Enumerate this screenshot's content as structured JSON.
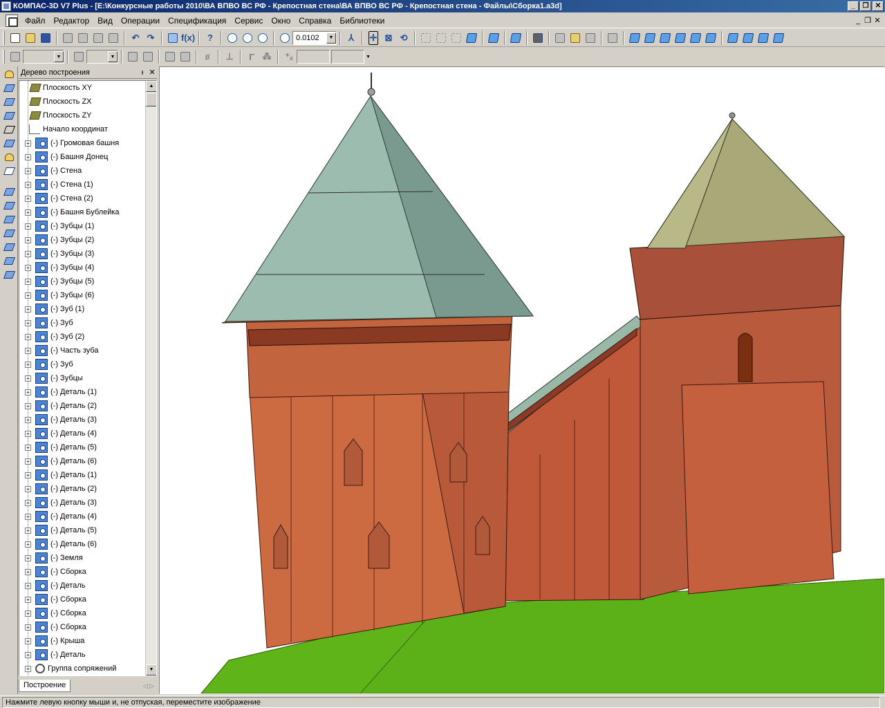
{
  "window": {
    "title": "КОМПАС-3D V7 Plus - [E:\\Конкурсные работы 2010\\ВА ВПВО ВС РФ - Крепостная стена\\ВА ВПВО ВС РФ - Крепостная стена - Файлы\\Сборка1.a3d]",
    "minimize": "_",
    "restore": "❐",
    "close": "✕"
  },
  "menu": {
    "items": [
      "Файл",
      "Редактор",
      "Вид",
      "Операции",
      "Спецификация",
      "Сервис",
      "Окно",
      "Справка",
      "Библиотеки"
    ]
  },
  "toolbar": {
    "zoom_value": "0.0102"
  },
  "tree": {
    "header": "Дерево построения",
    "pin": "ᵻ",
    "close": "✕",
    "rows": [
      {
        "type": "plane",
        "label": "Плоскость XY"
      },
      {
        "type": "plane",
        "label": "Плоскость ZX"
      },
      {
        "type": "plane",
        "label": "Плоскость ZY"
      },
      {
        "type": "origin",
        "label": "Начало координат"
      },
      {
        "type": "comp",
        "label": "(-) Громовая башня"
      },
      {
        "type": "comp",
        "label": "(-) Башня Донец"
      },
      {
        "type": "comp",
        "label": "(-) Стена"
      },
      {
        "type": "comp",
        "label": "(-) Стена (1)"
      },
      {
        "type": "comp",
        "label": "(-) Стена (2)"
      },
      {
        "type": "comp",
        "label": "(-) Башня Бублейка"
      },
      {
        "type": "comp",
        "label": "(-) Зубцы (1)"
      },
      {
        "type": "comp",
        "label": "(-) Зубцы (2)"
      },
      {
        "type": "comp",
        "label": "(-) Зубцы (3)"
      },
      {
        "type": "comp",
        "label": "(-) Зубцы (4)"
      },
      {
        "type": "comp",
        "label": "(-) Зубцы (5)"
      },
      {
        "type": "comp",
        "label": "(-) Зубцы (6)"
      },
      {
        "type": "comp",
        "label": "(-) Зуб (1)"
      },
      {
        "type": "comp",
        "label": "(-) Зуб"
      },
      {
        "type": "comp",
        "label": "(-) Зуб (2)"
      },
      {
        "type": "comp",
        "label": "(-) Часть зуба"
      },
      {
        "type": "comp",
        "label": "(-) Зуб"
      },
      {
        "type": "comp",
        "label": "(-) Зубцы"
      },
      {
        "type": "comp",
        "label": "(-) Деталь (1)"
      },
      {
        "type": "comp",
        "label": "(-) Деталь (2)"
      },
      {
        "type": "comp",
        "label": "(-) Деталь (3)"
      },
      {
        "type": "comp",
        "label": "(-) Деталь (4)"
      },
      {
        "type": "comp",
        "label": "(-) Деталь (5)"
      },
      {
        "type": "comp",
        "label": "(-) Деталь (6)"
      },
      {
        "type": "comp",
        "label": "(-) Деталь (1)"
      },
      {
        "type": "comp",
        "label": "(-) Деталь (2)"
      },
      {
        "type": "comp",
        "label": "(-) Деталь (3)"
      },
      {
        "type": "comp",
        "label": "(-) Деталь (4)"
      },
      {
        "type": "comp",
        "label": "(-) Деталь (5)"
      },
      {
        "type": "comp",
        "label": "(-) Деталь (6)"
      },
      {
        "type": "comp",
        "label": "(-) Земля"
      },
      {
        "type": "comp",
        "label": "(-) Сборка"
      },
      {
        "type": "comp",
        "label": "(-) Деталь"
      },
      {
        "type": "comp",
        "label": "(-) Сборка"
      },
      {
        "type": "comp",
        "label": "(-) Сборка"
      },
      {
        "type": "comp",
        "label": "(-) Сборка"
      },
      {
        "type": "comp",
        "label": "(-) Крыша"
      },
      {
        "type": "comp",
        "label": "(-) Деталь"
      },
      {
        "type": "mates",
        "label": "Группа сопряжений"
      }
    ],
    "tab": "Построение",
    "nav": "◁ ▷"
  },
  "status": {
    "text": "Нажмите левую кнопку мыши и, не отпуская, переместите изображение"
  },
  "colors": {
    "brick": "#c8643c",
    "roof_round": "#9cbcb0",
    "roof_square": "#a8a878",
    "ground": "#5fb41a"
  }
}
